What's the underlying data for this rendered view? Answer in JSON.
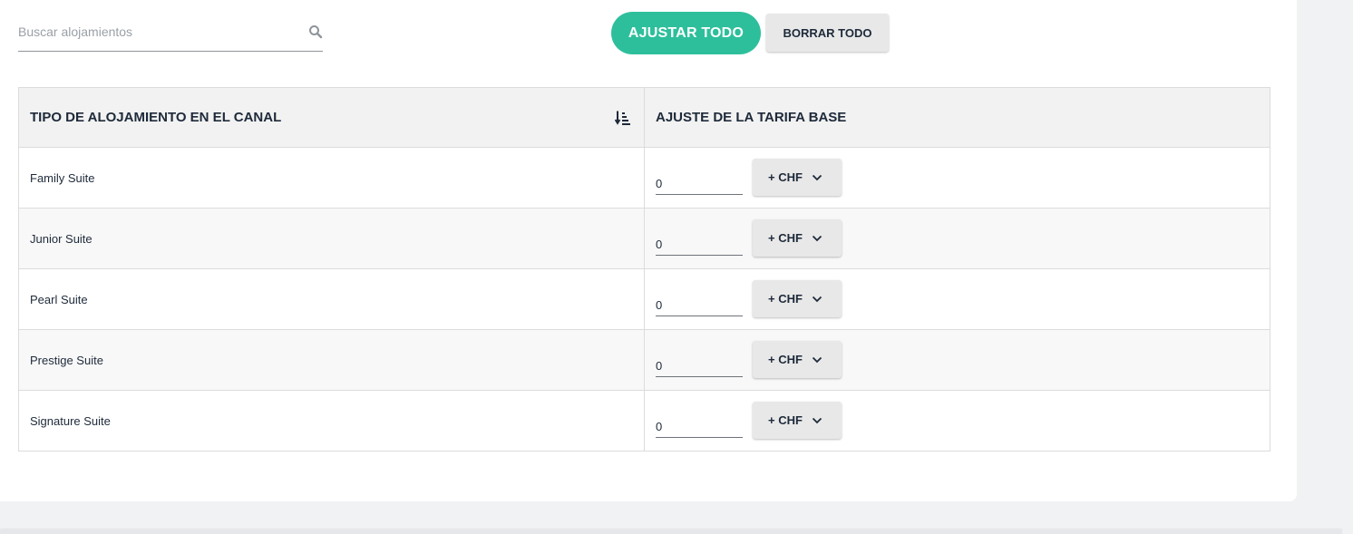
{
  "search": {
    "placeholder": "Buscar alojamientos",
    "value": ""
  },
  "actions": {
    "adjust_all": "AJUSTAR TODO",
    "clear_all": "BORRAR TODO"
  },
  "table": {
    "headers": {
      "room_type": "TIPO DE ALOJAMIENTO EN EL CANAL",
      "rate_adjustment": "AJUSTE DE LA TARIFA BASE"
    },
    "rows": [
      {
        "name": "Family Suite",
        "value": "0",
        "unit": "+ CHF"
      },
      {
        "name": "Junior Suite",
        "value": "0",
        "unit": "+ CHF"
      },
      {
        "name": "Pearl Suite",
        "value": "0",
        "unit": "+ CHF"
      },
      {
        "name": "Prestige Suite",
        "value": "0",
        "unit": "+ CHF"
      },
      {
        "name": "Signature Suite",
        "value": "0",
        "unit": "+ CHF"
      }
    ]
  },
  "colors": {
    "accent": "#2dbf9b",
    "text": "#1e2a3a"
  },
  "icons": {
    "search": "search-icon",
    "sort": "sort-ascending-icon",
    "dropdown": "chevron-down-icon"
  }
}
